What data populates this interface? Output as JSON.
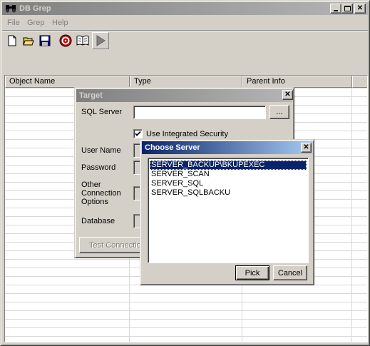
{
  "app": {
    "title": "DB Grep"
  },
  "menu": [
    "File",
    "Grep",
    "Help"
  ],
  "toolbar": {
    "buttons": [
      {
        "icon": "new-document-icon"
      },
      {
        "icon": "open-folder-icon"
      },
      {
        "icon": "save-icon"
      },
      {
        "icon": "target-icon"
      },
      {
        "icon": "book-icon"
      },
      {
        "icon": "run-icon"
      }
    ]
  },
  "grid": {
    "columns": [
      "Object Name",
      "Type",
      "Parent Info"
    ]
  },
  "target_dialog": {
    "title": "Target",
    "sql_server_label": "SQL Server",
    "sql_server_value": "",
    "browse_label": "...",
    "integrated_security_label": "Use Integrated Security",
    "integrated_security_checked": true,
    "user_name_label": "User Name",
    "password_label": "Password",
    "other_options_label_1": "Other",
    "other_options_label_2": "Connection",
    "other_options_label_3": "Options",
    "database_label": "Database",
    "test_button_label": "Test Connectio"
  },
  "choose_server_dialog": {
    "title": "Choose Server",
    "servers": [
      "SERVER_BACKUP\\BKUPEXEC",
      "SERVER_SCAN",
      "SERVER_SQL",
      "SERVER_SQLBACKU"
    ],
    "selected_index": 0,
    "pick_label": "Pick",
    "cancel_label": "Cancel"
  },
  "colors": {
    "active_title": "#0a246a",
    "inactive_title": "#808080",
    "face": "#d4d0c8"
  }
}
